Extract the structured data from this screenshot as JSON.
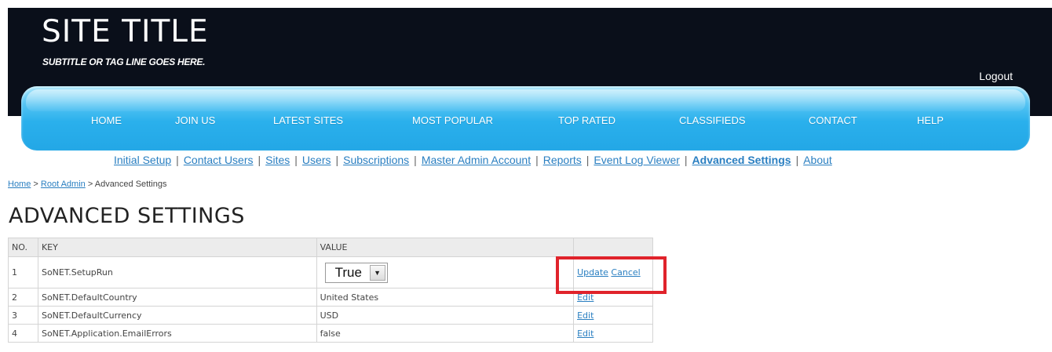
{
  "header": {
    "title": "SITE TITLE",
    "subtitle": "SUBTITLE OR TAG LINE GOES HERE.",
    "logout_label": "Logout"
  },
  "nav": {
    "items": [
      "HOME",
      "JOIN US",
      "LATEST SITES",
      "MOST POPULAR",
      "TOP RATED",
      "CLASSIFIEDS",
      "CONTACT",
      "HELP"
    ]
  },
  "submenu": {
    "items": [
      "Initial Setup",
      "Contact Users",
      "Sites",
      "Users",
      "Subscriptions",
      "Master Admin Account",
      "Reports",
      "Event Log Viewer",
      "Advanced Settings",
      "About"
    ],
    "separator": "|"
  },
  "breadcrumb": {
    "home": "Home",
    "sep": ">",
    "root_admin": "Root Admin",
    "current": "Advanced Settings"
  },
  "page": {
    "title": "ADVANCED SETTINGS"
  },
  "table": {
    "headers": {
      "no": "NO.",
      "key": "KEY",
      "value": "VALUE",
      "actions": ""
    },
    "editing_row": {
      "no": "1",
      "key": "SoNET.SetupRun",
      "select_value": "True",
      "update_label": "Update",
      "cancel_label": "Cancel"
    },
    "rows": [
      {
        "no": "2",
        "key": "SoNET.DefaultCountry",
        "value": "United States",
        "action": "Edit"
      },
      {
        "no": "3",
        "key": "SoNET.DefaultCurrency",
        "value": "USD",
        "action": "Edit"
      },
      {
        "no": "4",
        "key": "SoNET.Application.EmailErrors",
        "value": "false",
        "action": "Edit"
      }
    ]
  },
  "colors": {
    "header_bg": "#0a0f1a",
    "nav_blue": "#2ab0ec",
    "link_blue": "#2a7fc1",
    "highlight_red": "#e0232b"
  },
  "icons": {
    "select_arrow": "chevron-down-icon"
  }
}
